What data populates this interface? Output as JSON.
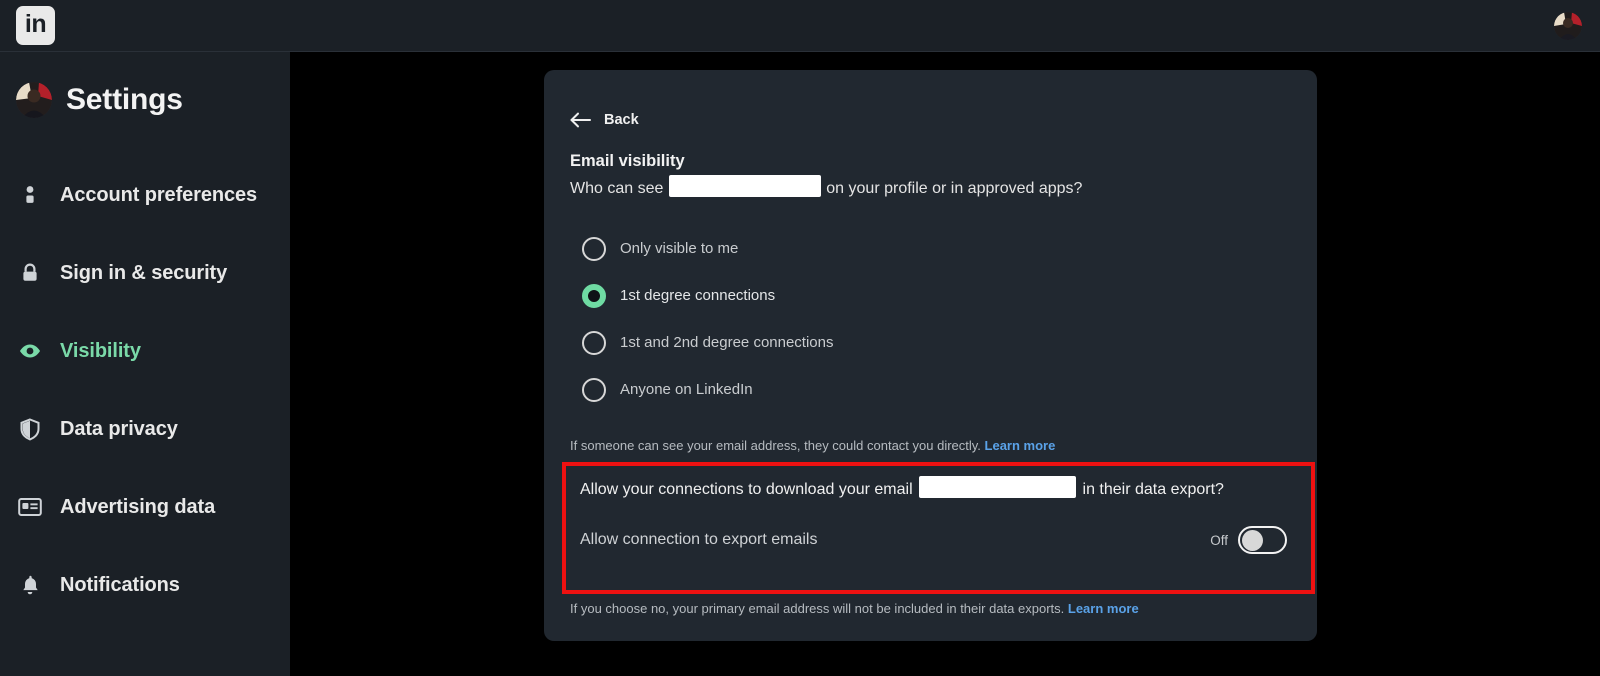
{
  "topbar": {
    "logo_text": "in",
    "logo_icon": "linkedin-logo-icon",
    "avatar_icon": "user-avatar-icon"
  },
  "sidebar": {
    "title": "Settings",
    "items": [
      {
        "label": "Account preferences",
        "icon": "person-icon",
        "active": false
      },
      {
        "label": "Sign in & security",
        "icon": "lock-icon",
        "active": false
      },
      {
        "label": "Visibility",
        "icon": "eye-icon",
        "active": true
      },
      {
        "label": "Data privacy",
        "icon": "shield-icon",
        "active": false
      },
      {
        "label": "Advertising data",
        "icon": "id-card-icon",
        "active": false
      },
      {
        "label": "Notifications",
        "icon": "bell-icon",
        "active": false
      }
    ]
  },
  "panel": {
    "back_label": "Back",
    "back_icon": "arrow-left-icon",
    "section_title": "Email visibility",
    "question_prefix": "Who can see ",
    "question_suffix": " on your profile or in approved apps?",
    "options": [
      {
        "label": "Only visible to me",
        "selected": false
      },
      {
        "label": "1st degree connections",
        "selected": true
      },
      {
        "label": "1st and 2nd degree connections",
        "selected": false
      },
      {
        "label": "Anyone on LinkedIn",
        "selected": false
      }
    ],
    "note_contact": "If someone can see your email address, they could contact you directly. ",
    "note_contact_link": "Learn more",
    "export": {
      "question_prefix": "Allow your connections to download your email ",
      "question_suffix": " in their data export?",
      "toggle_label": "Allow connection to export emails",
      "toggle_state": "Off",
      "toggle_on": false
    },
    "note_export": "If you choose no, your primary email address will not be included in their data exports. ",
    "note_export_link": "Learn more"
  },
  "colors": {
    "accent_green": "#7ad9a8",
    "link_blue": "#5aa2e8",
    "highlight_red": "#ee1111",
    "panel_bg": "#212830",
    "sidebar_bg": "#1b2026",
    "page_bg": "#000000"
  }
}
